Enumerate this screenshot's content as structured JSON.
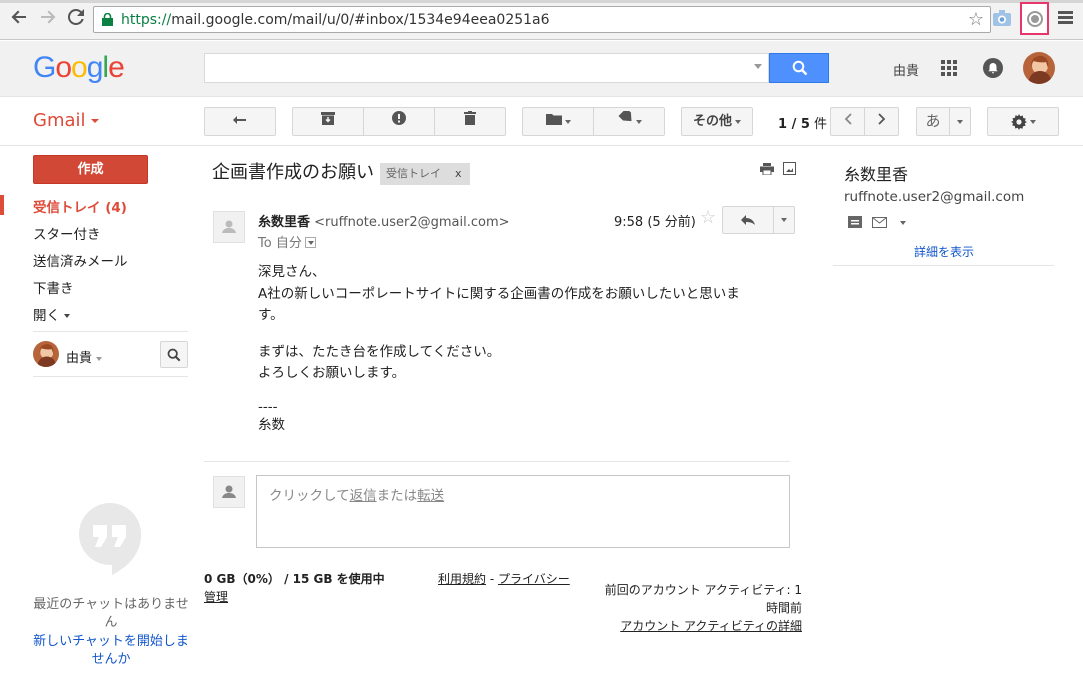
{
  "browser": {
    "url_scheme": "https://",
    "url_rest": "mail.google.com/mail/u/0/#inbox/1534e94eea0251a6"
  },
  "header": {
    "logo_letters": [
      "G",
      "o",
      "o",
      "g",
      "l",
      "e"
    ],
    "logo_colors": [
      "#4285f4",
      "#ea4335",
      "#fbbc05",
      "#4285f4",
      "#34a853",
      "#ea4335"
    ],
    "search_value": "",
    "user_name": "由貴"
  },
  "toolbar": {
    "app_label": "Gmail",
    "more_label": "その他",
    "pager_range": "1 / 5",
    "pager_unit": " 件",
    "ime_label": "あ"
  },
  "nav": {
    "compose_label": "作成",
    "items": [
      {
        "label": "受信トレイ (4)",
        "active": true
      },
      {
        "label": "スター付き",
        "active": false
      },
      {
        "label": "送信済みメール",
        "active": false
      },
      {
        "label": "下書き",
        "active": false
      },
      {
        "label": "開く",
        "active": false
      }
    ],
    "chat_user": "由貴",
    "no_chat_text": "最近のチャットはありません",
    "new_chat_text": "新しいチャットを開始しませんか"
  },
  "message": {
    "subject": "企画書作成のお願い",
    "label_chip": "受信トレイ",
    "label_close": "x",
    "sender_name": "糸数里香",
    "sender_email": "<ruffnote.user2@gmail.com>",
    "to_prefix": "To",
    "to_name": "自分",
    "time": "9:58 (5 分前)",
    "body": [
      "深見さん、",
      "A社の新しいコーポレートサイトに関する企画書の作成をお願いしたいと思いま",
      "す。",
      "",
      "まずは、たたき台を作成してください。",
      "よろしくお願いします。",
      "",
      "----",
      "糸数"
    ],
    "reply_prompt_pre": "クリックして",
    "reply_prompt_reply": "返信",
    "reply_prompt_mid": "または",
    "reply_prompt_forward": "転送"
  },
  "footer": {
    "storage": "0 GB（0%） / 15 GB を使用中",
    "manage": "管理",
    "terms": "利用規約",
    "dash": " - ",
    "privacy": "プライバシー",
    "activity_line1": "前回のアカウント アクティビティ: 1",
    "activity_line2": "時間前",
    "activity_details": "アカウント アクティビティの詳細"
  },
  "contact_panel": {
    "name": "糸数里香",
    "email": "ruffnote.user2@gmail.com",
    "details_link": "詳細を表示"
  }
}
